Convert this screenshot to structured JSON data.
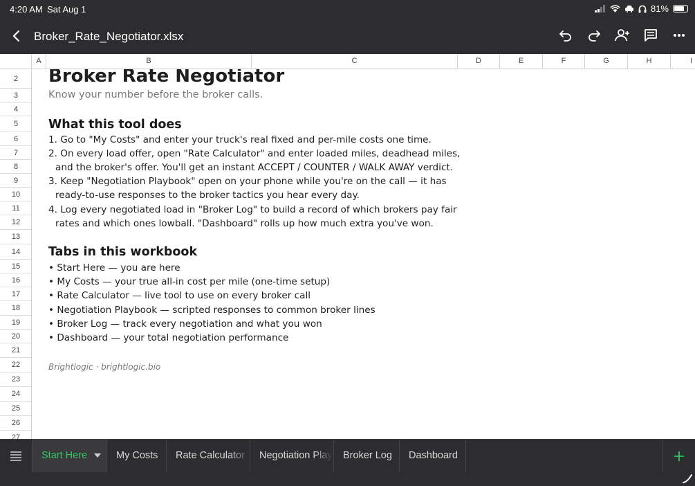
{
  "status_bar": {
    "time": "4:20 AM",
    "date": "Sat Aug 1",
    "battery": "81%"
  },
  "toolbar": {
    "filename": "Broker_Rate_Negotiator.xlsx"
  },
  "columns": [
    "A",
    "B",
    "C",
    "D",
    "E",
    "F",
    "G",
    "H",
    "I"
  ],
  "rows": [
    "2",
    "3",
    "4",
    "5",
    "6",
    "7",
    "8",
    "9",
    "10",
    "11",
    "12",
    "13",
    "14",
    "15",
    "16",
    "17",
    "18",
    "19",
    "20",
    "21",
    "22",
    "23",
    "24",
    "25",
    "26",
    "27"
  ],
  "content": {
    "title": "Broker Rate Negotiator",
    "subtitle": "Know your number before the broker calls.",
    "section1_heading": "What this tool does",
    "steps": [
      "1. Go to \"My Costs\" and enter your truck's real fixed and per-mile costs one time.",
      "2. On every load offer, open \"Rate Calculator\" and enter loaded miles, deadhead miles,",
      "and the broker's offer. You'll get an instant ACCEPT / COUNTER / WALK AWAY verdict.",
      "3. Keep \"Negotiation Playbook\" open on your phone while you're on the call — it has",
      "ready-to-use responses to the broker tactics you hear every day.",
      "4. Log every negotiated load in \"Broker Log\" to build a record of which brokers pay fair",
      "rates and which ones lowball. \"Dashboard\" rolls up how much extra you've won."
    ],
    "section2_heading": "Tabs in this workbook",
    "tabs_list": [
      "Start Here — you are here",
      "My Costs — your true all-in cost per mile (one-time setup)",
      "Rate Calculator — live tool to use on every broker call",
      "Negotiation Playbook — scripted responses to common broker lines",
      "Broker Log — track every negotiation and what you won",
      "Dashboard — your total negotiation performance"
    ],
    "credit": "Brightlogic  ·  brightlogic.bio"
  },
  "sheet_tabs": [
    "Start Here",
    "My Costs",
    "Rate Calculator",
    "Negotiation Playbook",
    "Broker Log",
    "Dashboard"
  ],
  "colors": {
    "chrome": "#2d2d2f",
    "active_tab": "#2ec866"
  }
}
